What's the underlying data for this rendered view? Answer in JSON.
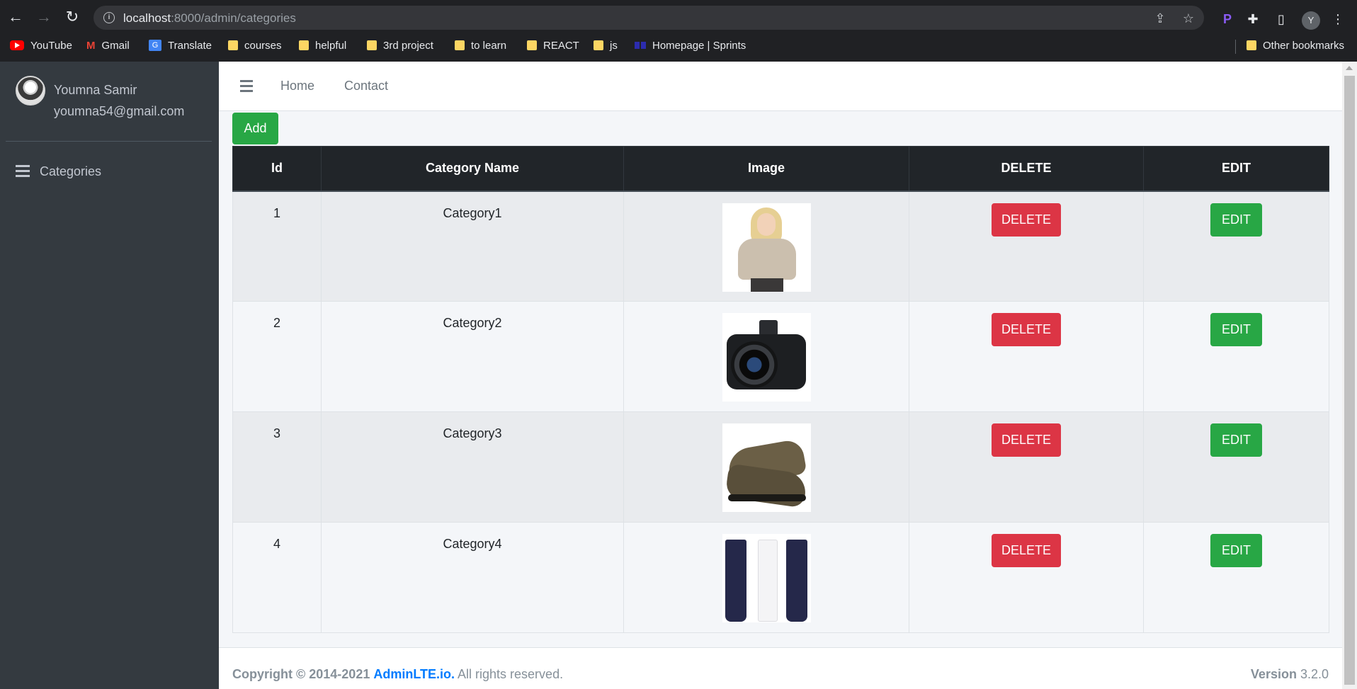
{
  "browser": {
    "url_host": "localhost",
    "url_rest": ":8000/admin/categories",
    "profile_initial": "Y",
    "bookmarks": [
      {
        "label": "YouTube",
        "icon": "youtube-icon"
      },
      {
        "label": "Gmail",
        "icon": "gmail-icon"
      },
      {
        "label": "Translate",
        "icon": "translate-icon"
      },
      {
        "label": "courses",
        "icon": "folder-icon"
      },
      {
        "label": "helpful",
        "icon": "folder-icon"
      },
      {
        "label": "3rd project",
        "icon": "folder-icon"
      },
      {
        "label": "to learn",
        "icon": "folder-icon"
      },
      {
        "label": "REACT",
        "icon": "folder-icon"
      },
      {
        "label": "js",
        "icon": "folder-icon"
      },
      {
        "label": "Homepage | Sprints",
        "icon": "sprints-icon"
      }
    ],
    "other_bookmarks": "Other bookmarks"
  },
  "sidebar": {
    "user_name": "Youmna Samir",
    "user_email": "youmna54@gmail.com",
    "items": [
      {
        "label": "Categories",
        "icon": "bars-icon"
      }
    ]
  },
  "navbar": {
    "links": [
      "Home",
      "Contact"
    ]
  },
  "content": {
    "add_label": "Add",
    "table": {
      "headers": [
        "Id",
        "Category Name",
        "Image",
        "DELETE",
        "EDIT"
      ],
      "rows": [
        {
          "id": "1",
          "name": "Category1",
          "image": "sweater-photo",
          "delete_label": "DELETE",
          "edit_label": "EDIT"
        },
        {
          "id": "2",
          "name": "Category2",
          "image": "camera-photo",
          "delete_label": "DELETE",
          "edit_label": "EDIT"
        },
        {
          "id": "3",
          "name": "Category3",
          "image": "shoes-photo",
          "delete_label": "DELETE",
          "edit_label": "EDIT"
        },
        {
          "id": "4",
          "name": "Category4",
          "image": "cosmetics-photo",
          "delete_label": "DELETE",
          "edit_label": "EDIT"
        }
      ]
    }
  },
  "footer": {
    "copyright_prefix": "Copyright © 2014-2021",
    "link": "AdminLTE.io.",
    "suffix": " All rights reserved.",
    "version_label": "Version",
    "version_number": " 3.2.0"
  },
  "colors": {
    "sidebar": "#343a40",
    "table_header": "#212529",
    "delete": "#dc3545",
    "success": "#28a745",
    "link": "#007bff"
  }
}
